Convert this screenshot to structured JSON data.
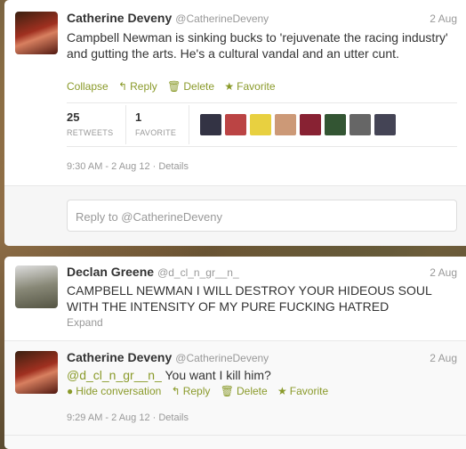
{
  "tweet1": {
    "name": "Catherine Deveny",
    "handle": "@CatherineDeveny",
    "date": "2 Aug",
    "text": "Campbell Newman is sinking bucks to 'rejuvenate the racing industry' and gutting the arts. He's a cultural vandal and an utter cunt.",
    "actions": {
      "collapse": "Collapse",
      "reply": "Reply",
      "delete": "Delete",
      "favorite": "Favorite"
    },
    "retweets": "25",
    "retweets_label": "RETWEETS",
    "favorites": "1",
    "favorites_label": "FAVORITE",
    "timestamp": "9:30 AM - 2 Aug 12",
    "details": "Details",
    "reply_placeholder": "Reply to @CatherineDeveny"
  },
  "tweet2": {
    "name": "Declan Greene",
    "handle": "@d_cl_n_gr__n_",
    "date": "2 Aug",
    "text": "CAMPBELL NEWMAN I WILL DESTROY YOUR HIDEOUS SOUL WITH THE INTENSITY OF MY PURE FUCKING HATRED",
    "expand": "Expand"
  },
  "tweet3": {
    "name": "Catherine Deveny",
    "handle": "@CatherineDeveny",
    "date": "2 Aug",
    "mention": "@d_cl_n_gr__n_",
    "text": " You want I kill him?",
    "actions": {
      "hide": "Hide conversation",
      "reply": "Reply",
      "delete": "Delete",
      "favorite": "Favorite"
    },
    "timestamp": "9:29 AM - 2 Aug 12",
    "details": "Details"
  },
  "icons": {
    "reply": "reply-arrow-icon",
    "delete": "trash-icon",
    "favorite": "star-icon",
    "conversation": "speech-bubble-icon"
  },
  "colors": {
    "accent": "#8a9a2a",
    "text": "#333333",
    "muted": "#999999"
  }
}
